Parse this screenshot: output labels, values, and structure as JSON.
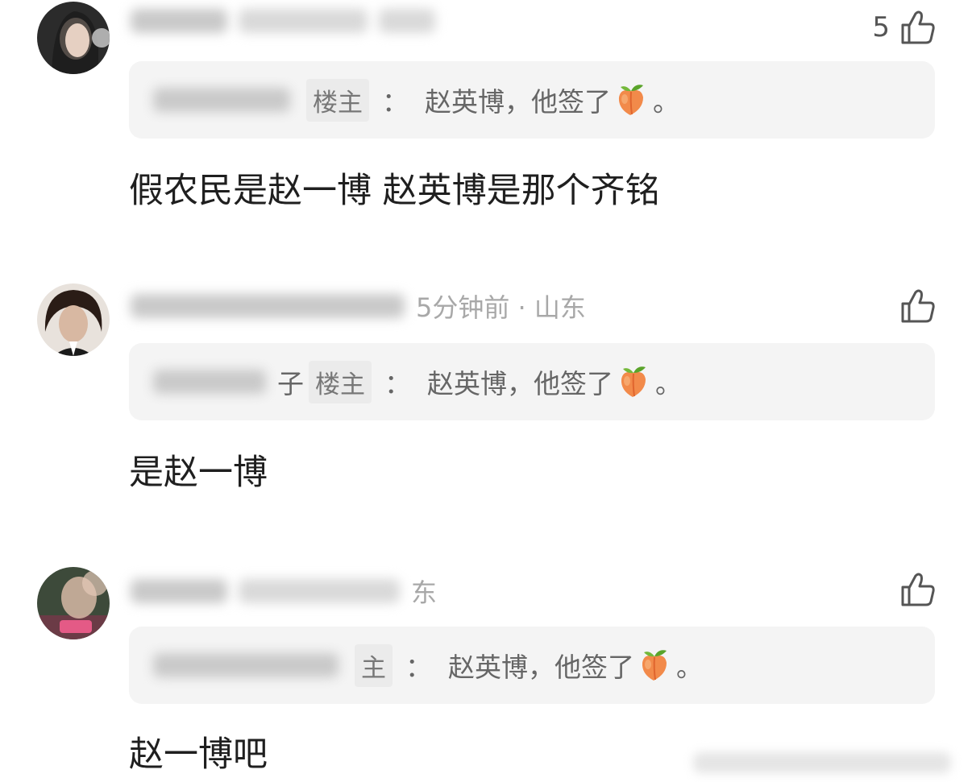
{
  "comments": [
    {
      "meta_text": "",
      "like_count": "5",
      "quote": {
        "name_suffix": "",
        "op_badge": "楼主",
        "colon": "：",
        "text": "赵英博，他签了",
        "end": "。"
      },
      "body": "假农民是赵一博 赵英博是那个齐铭"
    },
    {
      "meta_text": "5分钟前 · 山东",
      "like_count": "",
      "quote": {
        "name_suffix": "子",
        "op_badge": "楼主",
        "colon": "：",
        "text": "赵英博，他签了",
        "end": "。"
      },
      "body": "是赵一博"
    },
    {
      "meta_text": "东",
      "like_count": "",
      "quote": {
        "name_suffix": "",
        "op_badge": "主",
        "colon": "：",
        "text": "赵英博，他签了",
        "end": "。"
      },
      "body": "赵一博吧"
    }
  ],
  "icons": {
    "like": "thumbs-up-icon",
    "emoji": "peach-emoji-icon"
  },
  "colors": {
    "quote_bg": "#f4f4f4",
    "meta_gray": "#a8a8a8",
    "peach": "#f28a4a"
  }
}
